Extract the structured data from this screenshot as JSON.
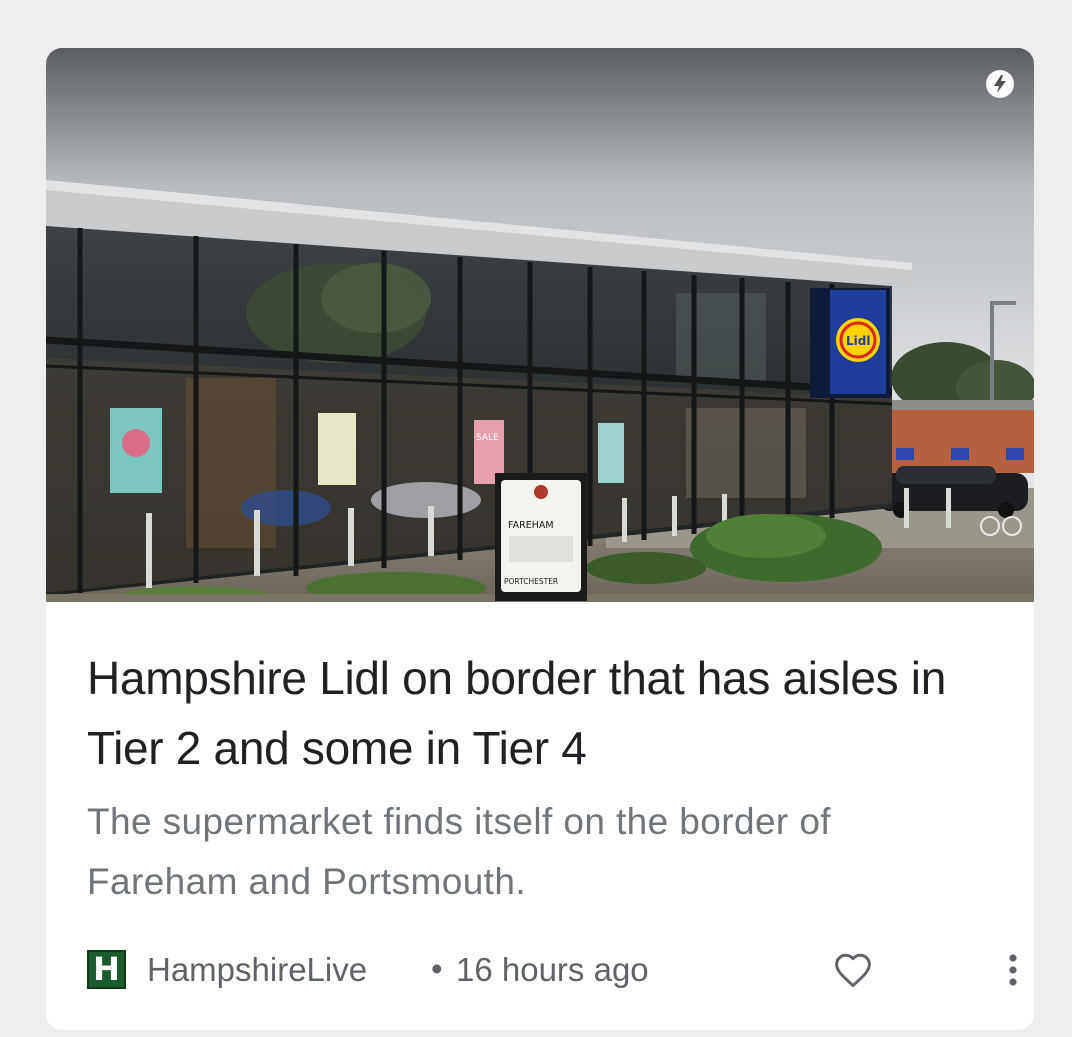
{
  "article": {
    "headline": "Hampshire Lidl on border that has aisles in Tier 2 and some in Tier 4",
    "summary": "The supermarket finds itself on the border of Fareham and Portsmouth.",
    "image": {
      "sign_top": "FAREHAM",
      "sign_bottom": "PORTCHESTER",
      "window_poster": "SALE",
      "store_logo": "Lidl"
    },
    "badge_icon": "amp-bolt-icon"
  },
  "source": {
    "logo_letter": "H",
    "name": "HampshireLive",
    "separator": "•",
    "time": "16 hours ago"
  },
  "actions": {
    "favorite_icon": "heart-outline-icon",
    "more_icon": "more-vert-icon"
  },
  "colors": {
    "headline": "#202124",
    "summary": "#70757a",
    "meta": "#5f6368",
    "source_logo_bg": "#1c5b2d",
    "lidl_blue": "#1f3e9c",
    "lidl_yellow": "#ffd200"
  }
}
